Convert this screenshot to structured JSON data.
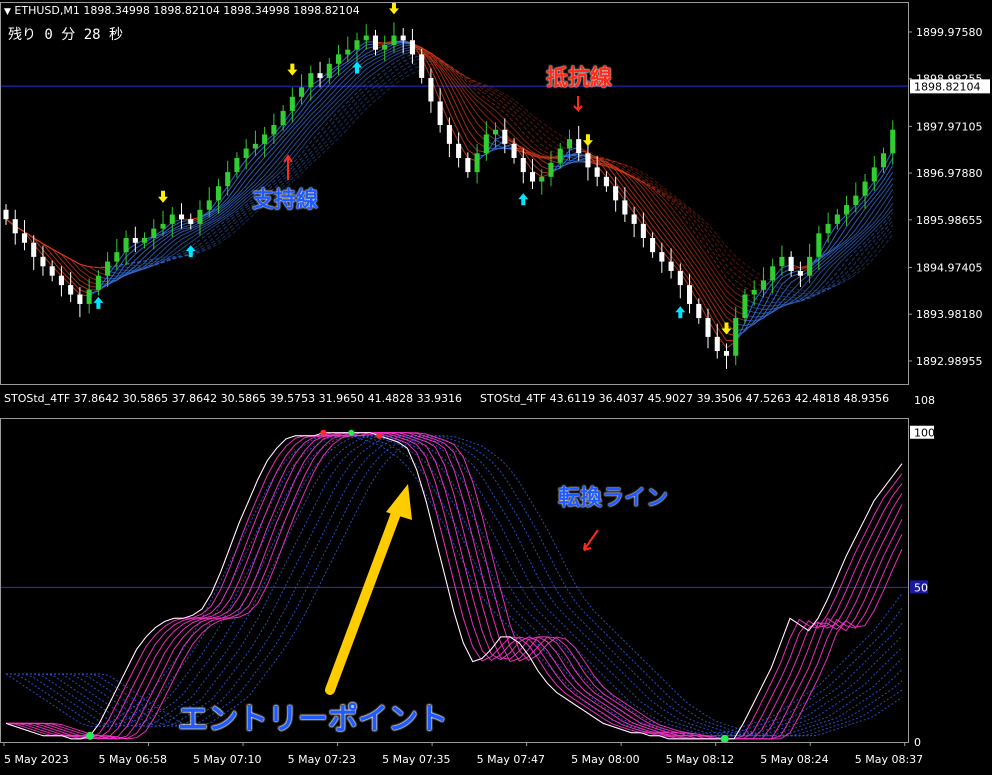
{
  "header": {
    "symbol_line": "ETHUSD,M1  1898.34998 1898.82104 1898.34998 1898.82104",
    "countdown": "残り 0 分 28 秒",
    "indicator_line_1": "STOStd_4TF 37.8642 30.5865 37.8642 30.5865 39.5753 31.9650 41.4828 33.9316",
    "indicator_line_2": "STOStd_4TF 43.6119 36.4037 45.9027 39.3506 47.5263 42.4818 48.9356"
  },
  "colors": {
    "background": "#000000",
    "grid": "#1b1b50",
    "bull_candle": "#32cd32",
    "bear_candle": "#ffffff",
    "resistance": "#d43a1a",
    "support": "#3a78e8",
    "stoch_fast": "#ff33cc",
    "stoch_slow": "#2a5adf",
    "annotation_red": "#ff2a1a",
    "annotation_blue": "#1e5aff",
    "annotation_yellow": "#ffcc00",
    "price_line": "#2b2bdc"
  },
  "annotations": {
    "resistance": "抵抗線",
    "support": "支持線",
    "turning_line": "転換ライン",
    "entry_point": "エントリーポイント"
  },
  "chart_data": [
    {
      "type": "candlestick",
      "title": "ETHUSD,M1",
      "ylim": [
        1892.5,
        1900.4
      ],
      "current_price": 1898.82104,
      "price_line_ticks": [
        1898.8255
      ],
      "yticks": [
        1899.9758,
        1898.9825,
        1897.97105,
        1896.9788,
        1895.98655,
        1894.97405,
        1893.9818,
        1892.98955
      ],
      "ytick_labels": [
        "1899.97580",
        "1898.98255",
        "1897.97105",
        "1896.97880",
        "1895.98655",
        "1894.97405",
        "1893.98180",
        "1892.98955"
      ],
      "current_price_label": "1898.82104",
      "close_series": [
        1896.0,
        1895.7,
        1895.5,
        1895.2,
        1895.0,
        1894.8,
        1894.6,
        1894.4,
        1894.2,
        1894.5,
        1894.8,
        1895.1,
        1895.3,
        1895.6,
        1895.5,
        1895.6,
        1895.8,
        1895.9,
        1896.1,
        1896.0,
        1895.9,
        1896.2,
        1896.4,
        1896.7,
        1897.0,
        1897.3,
        1897.5,
        1897.6,
        1897.8,
        1898.0,
        1898.3,
        1898.6,
        1898.8,
        1899.1,
        1899.0,
        1899.3,
        1899.5,
        1899.6,
        1899.8,
        1899.9,
        1899.6,
        1899.7,
        1899.9,
        1899.8,
        1899.5,
        1899.0,
        1898.5,
        1898.0,
        1897.6,
        1897.3,
        1897.0,
        1897.4,
        1897.8,
        1897.9,
        1897.6,
        1897.3,
        1897.0,
        1896.8,
        1896.9,
        1897.2,
        1897.5,
        1897.7,
        1897.4,
        1897.1,
        1896.9,
        1896.7,
        1896.4,
        1896.1,
        1895.9,
        1895.6,
        1895.3,
        1895.1,
        1894.9,
        1894.6,
        1894.2,
        1893.9,
        1893.5,
        1893.2,
        1893.1,
        1893.9,
        1894.4,
        1894.5,
        1894.7,
        1895.0,
        1895.2,
        1894.9,
        1894.8,
        1895.2,
        1895.7,
        1895.9,
        1896.1,
        1896.3,
        1896.5,
        1896.8,
        1897.1,
        1897.4,
        1897.9
      ],
      "buy_arrows_at": [
        10,
        20,
        38,
        56,
        73
      ],
      "sell_arrows_at": [
        17,
        31,
        42,
        63,
        78
      ]
    },
    {
      "type": "line",
      "title": "STOStd_4TF",
      "ylim": [
        0,
        108
      ],
      "yticks": [
        108,
        100,
        50,
        0
      ],
      "ytick_labels": [
        "108",
        "100",
        "50",
        "0"
      ],
      "level_line": 50,
      "series": [
        {
          "values": [
            6,
            5,
            4,
            3,
            2,
            2,
            2,
            1,
            1,
            2,
            6,
            12,
            18,
            24,
            30,
            34,
            37,
            39,
            40,
            40,
            41,
            43,
            48,
            55,
            63,
            71,
            78,
            85,
            91,
            95,
            98,
            99,
            99,
            99,
            100,
            100,
            100,
            100,
            100,
            100,
            99,
            98,
            97,
            95,
            88,
            78,
            66,
            54,
            42,
            32,
            26,
            27,
            30,
            34,
            34,
            32,
            28,
            23,
            19,
            16,
            14,
            12,
            10,
            8,
            6,
            5,
            4,
            3,
            3,
            2,
            2,
            1,
            1,
            1,
            1,
            1,
            1,
            1,
            1,
            6,
            12,
            18,
            24,
            32,
            40,
            38,
            36,
            40,
            46,
            53,
            60,
            66,
            72,
            78,
            82,
            86,
            90
          ]
        },
        {
          "values": [
            22,
            20,
            18,
            16,
            14,
            12,
            10,
            8,
            6,
            5,
            5,
            6,
            8,
            10,
            12,
            14,
            18,
            22,
            26,
            30,
            35,
            40,
            46,
            52,
            58,
            64,
            70,
            76,
            82,
            87,
            91,
            94,
            96,
            98,
            99,
            99,
            99,
            99,
            98,
            97,
            96,
            94,
            92,
            89,
            85,
            80,
            75,
            70,
            64,
            58,
            52,
            47,
            43,
            40,
            37,
            34,
            31,
            28,
            25,
            22,
            19,
            16,
            13,
            11,
            9,
            7,
            6,
            5,
            4,
            3,
            3,
            2,
            2,
            2,
            2,
            2,
            2,
            3,
            4,
            5,
            6,
            7,
            8,
            10,
            12,
            14,
            16,
            18,
            21,
            24,
            27,
            30,
            33,
            36,
            40,
            44,
            48
          ]
        }
      ],
      "signal_dots_at": [
        9,
        77
      ],
      "top_dots_at": [
        34,
        37,
        40
      ]
    }
  ],
  "xaxis": {
    "labels": [
      "5 May 2023",
      "5 May 06:58",
      "5 May 07:10",
      "5 May 07:23",
      "5 May 07:35",
      "5 May 07:47",
      "5 May 08:00",
      "5 May 08:12",
      "5 May 08:24",
      "5 May 08:37"
    ]
  }
}
